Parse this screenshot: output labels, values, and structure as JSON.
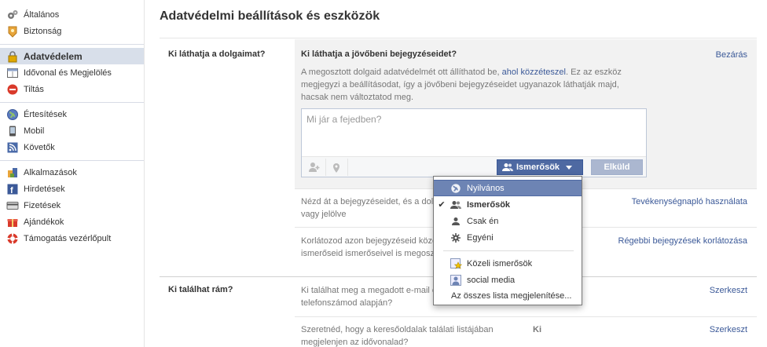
{
  "sidebar": {
    "groups": [
      [
        {
          "label": "Általános",
          "icon": "gears-icon"
        },
        {
          "label": "Biztonság",
          "icon": "badge-icon"
        }
      ],
      [
        {
          "label": "Adatvédelem",
          "icon": "lock-icon",
          "active": true
        },
        {
          "label": "Idővonal és Megjelölés",
          "icon": "timeline-icon"
        },
        {
          "label": "Tiltás",
          "icon": "block-icon"
        }
      ],
      [
        {
          "label": "Értesítések",
          "icon": "globe-icon"
        },
        {
          "label": "Mobil",
          "icon": "phone-icon"
        },
        {
          "label": "Követők",
          "icon": "rss-icon"
        }
      ],
      [
        {
          "label": "Alkalmazások",
          "icon": "apps-icon"
        },
        {
          "label": "Hirdetések",
          "icon": "ads-icon"
        },
        {
          "label": "Fizetések",
          "icon": "card-icon"
        },
        {
          "label": "Ajándékok",
          "icon": "gift-icon"
        },
        {
          "label": "Támogatás vezérlőpult",
          "icon": "lifebuoy-icon"
        }
      ]
    ]
  },
  "page": {
    "title": "Adatvédelmi beállítások és eszközök"
  },
  "sections": {
    "who_sees": {
      "label": "Ki láthatja a dolgaimat?"
    },
    "who_finds": {
      "label": "Ki találhat rám?"
    }
  },
  "expanded": {
    "title": "Ki láthatja a jövőbeni bejegyzéseidet?",
    "close": "Bezárás",
    "desc_before": "A megosztott dolgaid adatvédelmét ott állíthatod be, ",
    "desc_link": "ahol közzéteszel",
    "desc_after": ". Ez az eszköz megjegyzi a beállításodat, így a jövőbeni bejegyzéseidet ugyanazok láthatják majd, hacsak nem változtatod meg.",
    "composer_placeholder": "Mi jár a fejedben?",
    "audience_label": "Ismerősök",
    "send_label": "Elküld"
  },
  "rows": [
    {
      "desc": "Nézd át a bejegyzéseidet, és a dolgokat, amelyeken meg vagy jelölve",
      "link": "Tevékenységnapló használata"
    },
    {
      "desc": "Korlátozod azon bejegyzéseid közönségét, amelyeket az ismerőseid ismerőseivel is megosztottál, vagy nyilvánosak?",
      "link": "Régebbi bejegyzések korlátozása"
    },
    {
      "desc": "Ki találhat meg a megadott e-mail címed vagy telefonszámod alapján?",
      "link": "Szerkeszt"
    },
    {
      "desc": "Szeretnéd, hogy a keresőoldalak találati listájában megjelenjen az idővonalad?",
      "value": "Ki",
      "link": "Szerkeszt"
    }
  ],
  "dropdown": {
    "items": [
      {
        "label": "Nyilvános",
        "icon": "globe-icon",
        "highlight": true
      },
      {
        "label": "Ismerősök",
        "icon": "friends-icon",
        "selected": true
      },
      {
        "label": "Csak én",
        "icon": "person-icon"
      },
      {
        "label": "Egyéni",
        "icon": "gear-icon"
      },
      {
        "label": "Közeli ismerősök",
        "icon": "star-list-icon"
      },
      {
        "label": "social media",
        "icon": "list-icon"
      }
    ],
    "show_all": "Az összes lista megjelenítése..."
  }
}
